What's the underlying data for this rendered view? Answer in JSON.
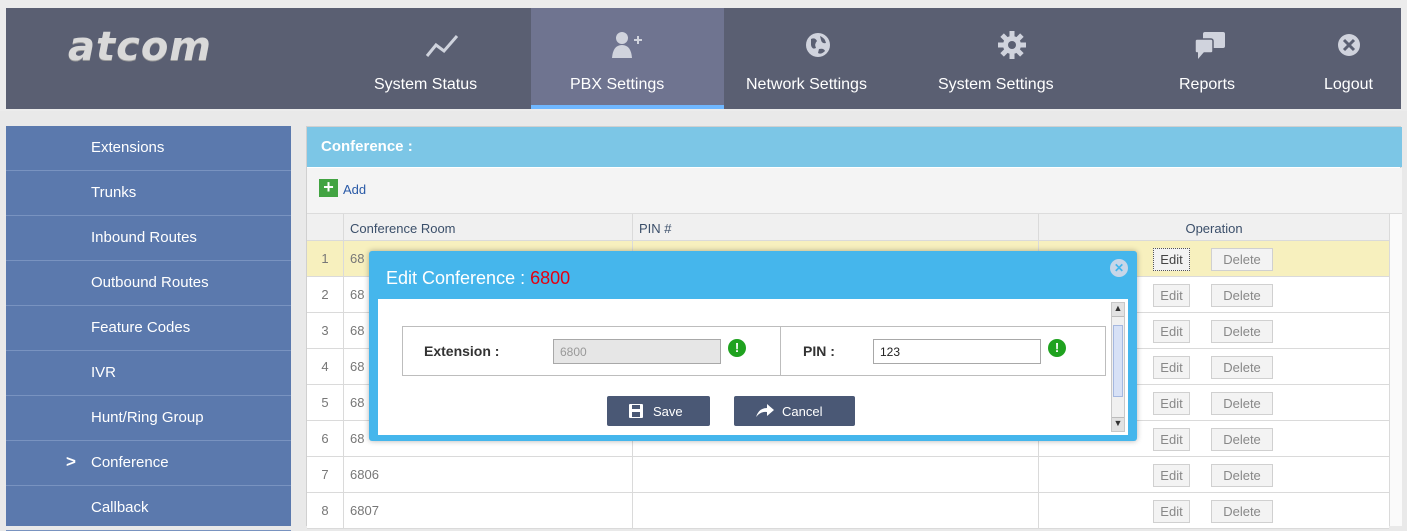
{
  "brand": {
    "logo_text": "atcom"
  },
  "nav": [
    {
      "label": "System Status",
      "icon": "chart-line-icon"
    },
    {
      "label": "PBX Settings",
      "icon": "add-user-icon",
      "active": true
    },
    {
      "label": "Network Settings",
      "icon": "globe-icon"
    },
    {
      "label": "System Settings",
      "icon": "gear-icon"
    },
    {
      "label": "Reports",
      "icon": "chat-bubbles-icon"
    },
    {
      "label": "Logout",
      "icon": "close-circle-icon"
    }
  ],
  "sidebar": {
    "items": [
      {
        "label": "Extensions"
      },
      {
        "label": "Trunks"
      },
      {
        "label": "Inbound Routes"
      },
      {
        "label": "Outbound Routes"
      },
      {
        "label": "Feature Codes"
      },
      {
        "label": "IVR"
      },
      {
        "label": "Hunt/Ring Group"
      },
      {
        "label": "Conference",
        "active": true,
        "marker": ">"
      },
      {
        "label": "Callback"
      }
    ]
  },
  "main": {
    "title": "Conference :",
    "add_label": "Add",
    "table": {
      "headers": [
        "Conference Room",
        "PIN #",
        "Operation"
      ],
      "rows": [
        {
          "num": "1",
          "room": "68",
          "pin": ""
        },
        {
          "num": "2",
          "room": "68",
          "pin": ""
        },
        {
          "num": "3",
          "room": "68",
          "pin": ""
        },
        {
          "num": "4",
          "room": "68",
          "pin": ""
        },
        {
          "num": "5",
          "room": "68",
          "pin": ""
        },
        {
          "num": "6",
          "room": "68",
          "pin": ""
        },
        {
          "num": "7",
          "room": "6806",
          "pin": ""
        },
        {
          "num": "8",
          "room": "6807",
          "pin": ""
        }
      ],
      "edit_label": "Edit",
      "delete_label": "Delete"
    }
  },
  "modal": {
    "title": "Edit Conference : ",
    "extension_number": "6800",
    "extension_label": "Extension :",
    "extension_value": "6800",
    "pin_label": "PIN :",
    "pin_value": "123",
    "required_mark": "!",
    "save_label": "Save",
    "cancel_label": "Cancel"
  },
  "colors": {
    "nav_bg": "#5a5f72",
    "nav_active": "#6f7490",
    "sidebar_bg": "#5b79ad",
    "header_bar": "#7cc6e6",
    "modal_bg": "#45b6ec",
    "selected_row": "#f7f0be",
    "required_green": "#1fa21f",
    "extension_red": "#e5000f"
  }
}
